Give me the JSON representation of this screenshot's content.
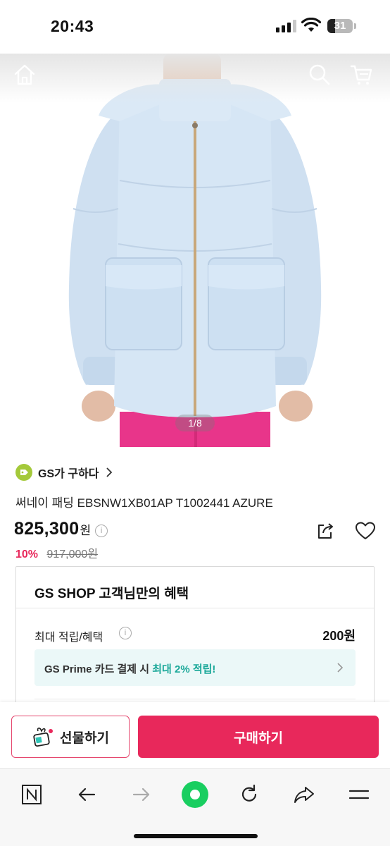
{
  "status_bar": {
    "time": "20:43",
    "battery": "31",
    "battery_level": 0.31
  },
  "product_image": {
    "counter": "1/8",
    "top_icons": [
      "home-icon",
      "search-icon",
      "cart-icon"
    ]
  },
  "product": {
    "brand_label": "GS가 구하다",
    "name": "써네이 패딩 EBSNW1XB01AP T1002441 AZURE",
    "price": "825,300",
    "price_unit": "원",
    "discount": "10%",
    "original_price": "917,000원"
  },
  "benefit": {
    "title": "GS SHOP 고객님만의 혜택",
    "max_label": "최대 적립/혜택",
    "max_value": "200원",
    "prime_text_prefix": "GS Prime 카드 결제 시 ",
    "prime_text_highlight": "최대 2% 적립!"
  },
  "purchase_bar": {
    "gift_label": "선물하기",
    "buy_label": "구매하기"
  },
  "browser_toolbar": {
    "icons": [
      "naver-n-icon",
      "back-arrow-icon",
      "forward-arrow-icon",
      "green-dot-icon",
      "reload-icon",
      "share-arrow-icon",
      "menu-icon"
    ]
  },
  "colors": {
    "accent_pink": "#e8285b",
    "prime_green": "#1aa899",
    "brand_green": "#a4c93a",
    "jacket_blue": "#d6e6f5",
    "pants_pink": "#e8358a"
  }
}
